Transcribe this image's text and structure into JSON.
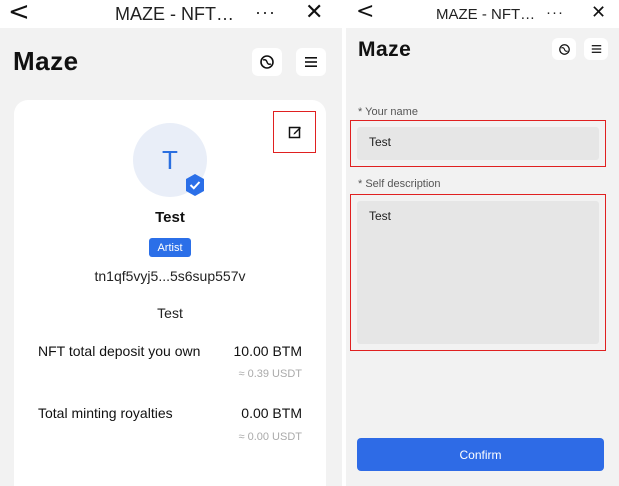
{
  "left": {
    "topbar": {
      "back": "<",
      "title": "MAZE - NFT…",
      "more": "···",
      "close": "✕"
    },
    "logo": "Maze",
    "header_icons": {
      "globe": "globe-icon",
      "menu": "menu-icon"
    },
    "profile": {
      "avatar_letter": "T",
      "name": "Test",
      "badge": "Artist",
      "address": "tn1qf5vyj5...5s6sup557v",
      "description": "Test"
    },
    "stats": [
      {
        "label": "NFT total deposit you own",
        "value": "10.00 BTM",
        "sub": "≈ 0.39 USDT"
      },
      {
        "label": "Total minting royalties",
        "value": "0.00 BTM",
        "sub": "≈ 0.00 USDT"
      }
    ]
  },
  "right": {
    "topbar": {
      "back": "<",
      "title": "MAZE - NFT…",
      "more": "···",
      "close": "✕"
    },
    "logo": "Maze",
    "form": {
      "name_label": "* Your name",
      "name_value": "Test",
      "desc_label": "* Self description",
      "desc_value": "Test",
      "confirm_label": "Confirm"
    }
  },
  "colors": {
    "accent": "#2e6be6",
    "highlight": "#e02020",
    "background": "#f2f2f2"
  }
}
